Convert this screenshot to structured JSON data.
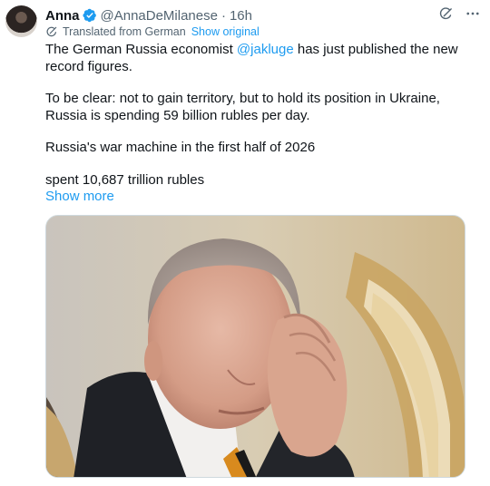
{
  "tweet": {
    "author_name": "Anna",
    "handle": "@AnnaDeMilanese",
    "separator": "·",
    "time": "16h",
    "translated_label": "Translated from German",
    "show_original_label": "Show original",
    "text_line1_pre": "The German Russia economist ",
    "mention": "@jakluge",
    "text_line1_post": " has just published the new record figures.",
    "paragraph2": "To be clear: not to gain territory, but to hold its position in Ukraine, Russia is spending 59 billion rubles per day.",
    "paragraph3": "Russia's war machine in the first half of 2026",
    "paragraph4": "spent 10,687 trillion rubles",
    "show_more_label": "Show more"
  },
  "colors": {
    "link": "#1d9bf0",
    "secondary_text": "#536471",
    "primary_text": "#0f1419",
    "verified_badge": "#1d9bf0"
  },
  "icons": {
    "verified": "verified-badge-icon",
    "grok": "grok-icon",
    "more": "more-icon",
    "translate": "translate-icon"
  }
}
